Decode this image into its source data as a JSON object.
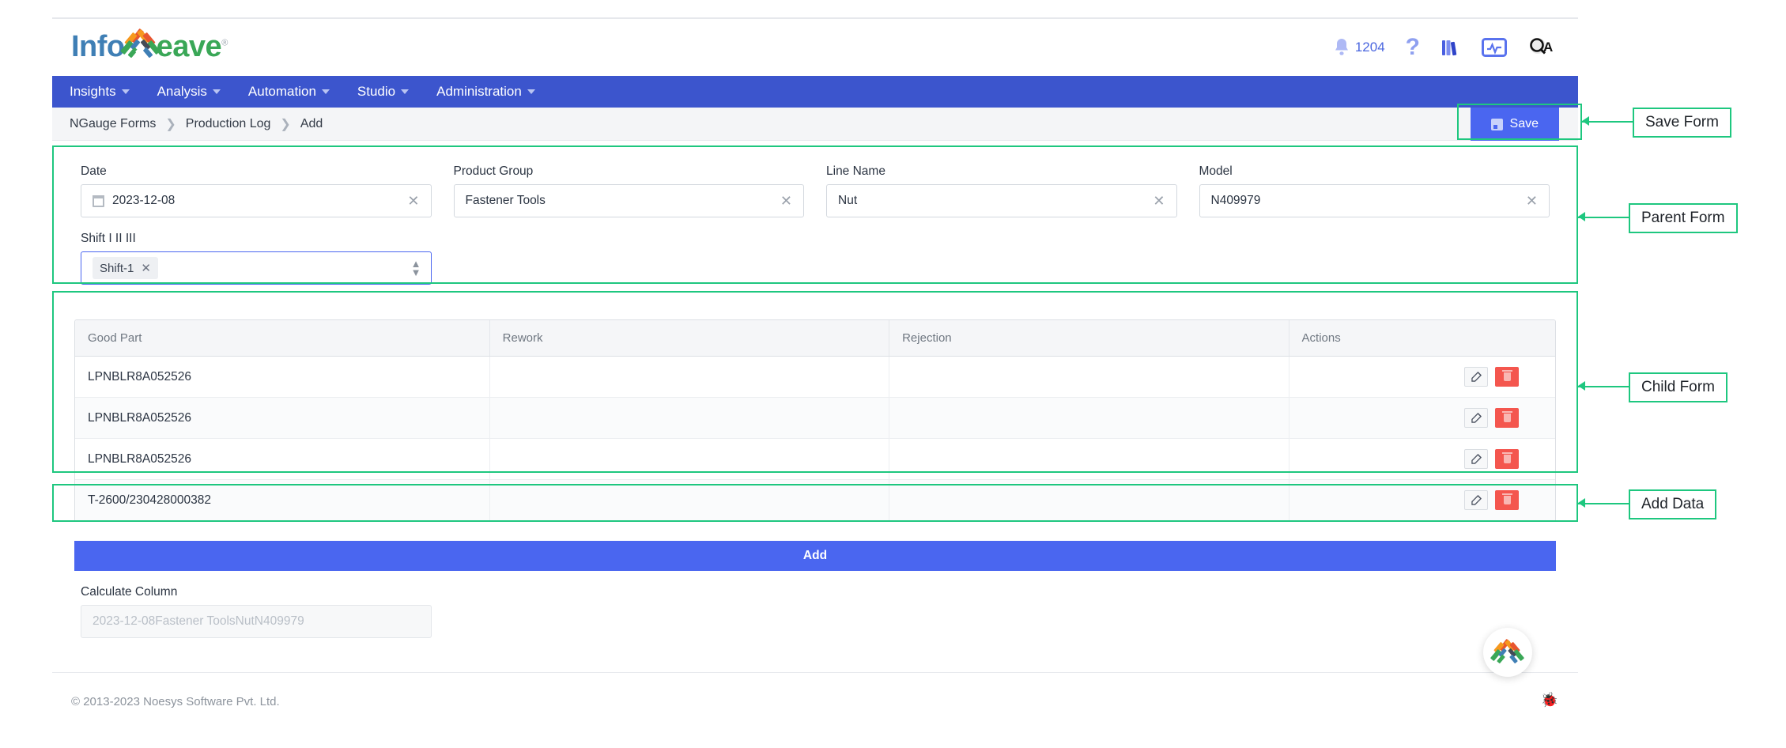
{
  "brand": {
    "name_part1": "Info",
    "name_part2": "eave",
    "registered": "®",
    "logo_icon": "infoveave-weave-logo"
  },
  "topbar": {
    "notification_count": "1204",
    "icons": [
      {
        "name": "notification-bell-icon",
        "glyph": "🔔"
      },
      {
        "name": "help-question-icon",
        "glyph": "?"
      },
      {
        "name": "library-books-icon",
        "glyph": "books"
      },
      {
        "name": "monitor-activity-icon",
        "glyph": "monitor"
      },
      {
        "name": "qa-user-avatar",
        "glyph": "QA"
      }
    ]
  },
  "nav": {
    "items": [
      {
        "label": "Insights"
      },
      {
        "label": "Analysis"
      },
      {
        "label": "Automation"
      },
      {
        "label": "Studio"
      },
      {
        "label": "Administration"
      }
    ]
  },
  "breadcrumb": {
    "items": [
      "NGauge Forms",
      "Production Log",
      "Add"
    ],
    "separator": "›"
  },
  "toolbar": {
    "save_label": "Save",
    "save_icon": "floppy-save-icon"
  },
  "parent_form": {
    "fields": [
      {
        "label": "Date",
        "value": "2023-12-08",
        "icon": "calendar-icon",
        "clear": "✕"
      },
      {
        "label": "Product Group",
        "value": "Fastener Tools",
        "clear": "✕"
      },
      {
        "label": "Line Name",
        "value": "Nut",
        "clear": "✕"
      },
      {
        "label": "Model",
        "value": "N409979",
        "clear": "✕"
      }
    ],
    "shift": {
      "label": "Shift I II III",
      "tag": "Shift-1",
      "tag_clear": "✕",
      "stepper_icon": "updown-chevron-icon"
    }
  },
  "child_form": {
    "columns": [
      "Good Part",
      "Rework",
      "Rejection",
      "Actions"
    ],
    "rows": [
      {
        "good_part": "LPNBLR8A052526",
        "rework": "",
        "rejection": ""
      },
      {
        "good_part": "LPNBLR8A052526",
        "rework": "",
        "rejection": ""
      },
      {
        "good_part": "LPNBLR8A052526",
        "rework": "",
        "rejection": ""
      },
      {
        "good_part": "T-2600/230428000382",
        "rework": "",
        "rejection": ""
      }
    ],
    "row_actions": {
      "edit_icon": "edit-pencil-icon",
      "delete_icon": "trash-delete-icon"
    }
  },
  "add_button": {
    "label": "Add"
  },
  "calculate_column": {
    "label": "Calculate Column",
    "placeholder": "2023-12-08Fastener ToolsNutN409979",
    "value": ""
  },
  "footer": {
    "copyright": "© 2013-2023 Noesys Software Pvt. Ltd."
  },
  "widgets": {
    "chat_icon": "infoveave-chat-logo-icon",
    "bug_icon": "bug-debug-icon",
    "bug_glyph": "🐞"
  },
  "annotations": [
    {
      "label": "Save Form"
    },
    {
      "label": "Parent Form"
    },
    {
      "label": "Child Form"
    },
    {
      "label": "Add Data"
    }
  ],
  "colors": {
    "nav_blue": "#3c55cd",
    "accent_blue": "#4a66f0",
    "delete_red": "#f4564e",
    "annotation_green": "#1ec77f",
    "brand_blue": "#3f7fb5",
    "brand_green": "#3aa757"
  }
}
